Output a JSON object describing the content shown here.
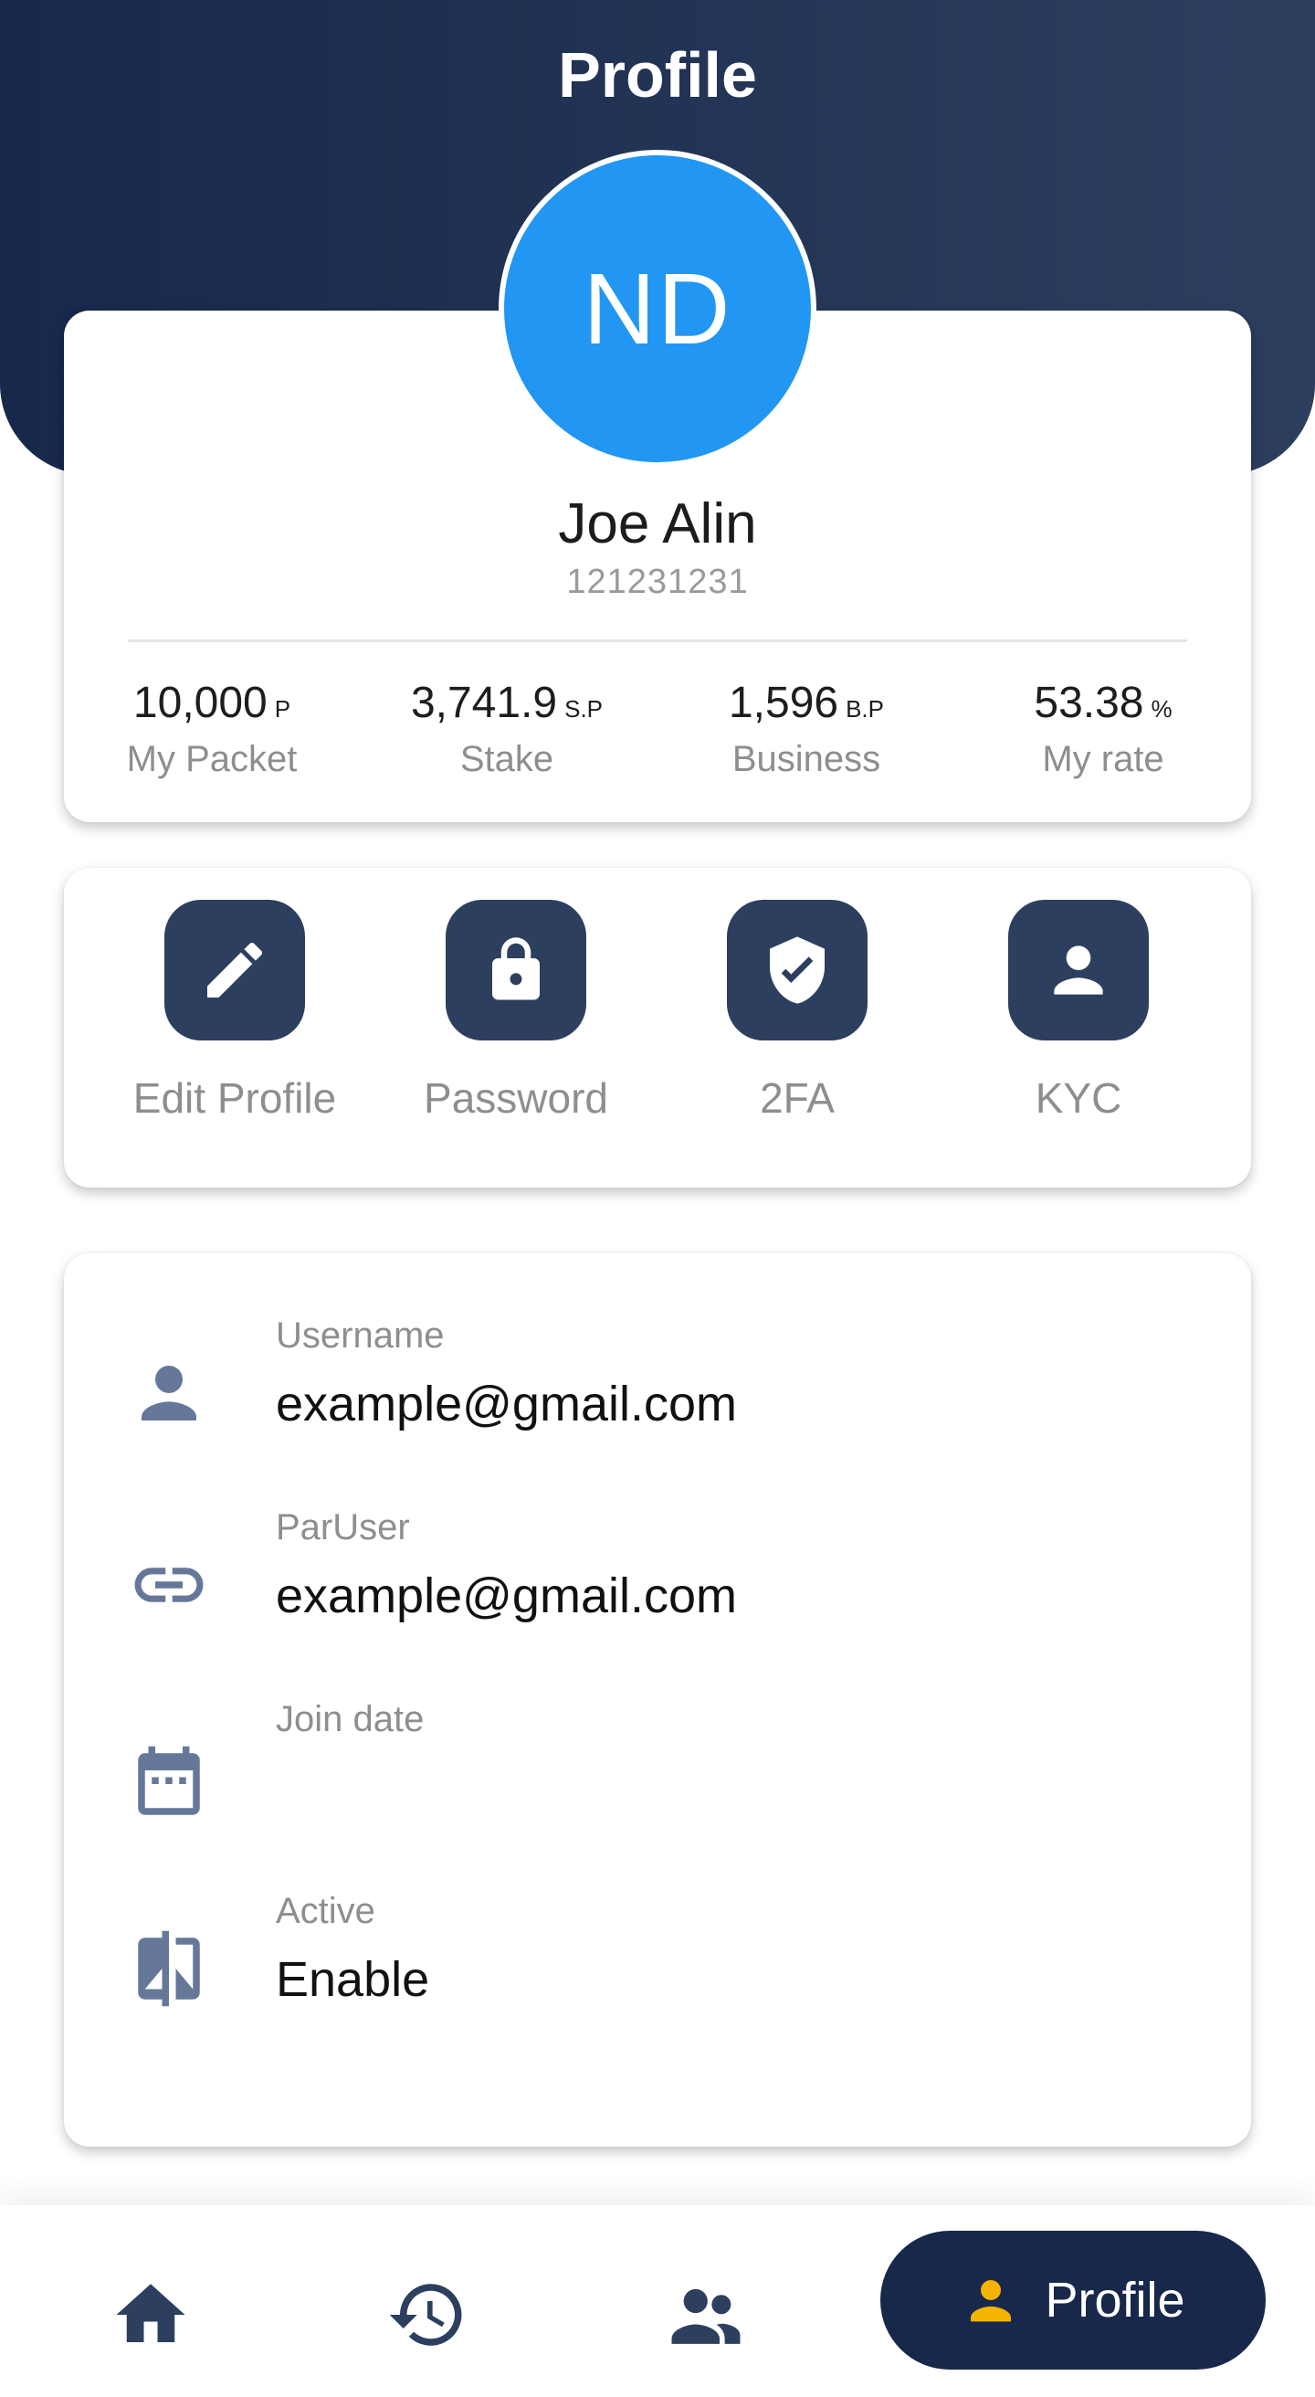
{
  "header": {
    "title": "Profile"
  },
  "profile": {
    "initials": "ND",
    "name": "Joe Alin",
    "id": "121231231",
    "stats": [
      {
        "value": "10,000",
        "unit": "P",
        "label": "My Packet"
      },
      {
        "value": "3,741.9",
        "unit": "S.P",
        "label": "Stake"
      },
      {
        "value": "1,596",
        "unit": "B.P",
        "label": "Business"
      },
      {
        "value": "53.38",
        "unit": "%",
        "label": "My rate"
      }
    ]
  },
  "actions": [
    {
      "label": "Edit Profile",
      "icon": "pencil-icon"
    },
    {
      "label": "Password",
      "icon": "lock-icon"
    },
    {
      "label": "2FA",
      "icon": "shield-check-icon"
    },
    {
      "label": "KYC",
      "icon": "person-icon"
    }
  ],
  "info": [
    {
      "label": "Username",
      "value": "example@gmail.com",
      "icon": "person-icon"
    },
    {
      "label": "ParUser",
      "value": "example@gmail.com",
      "icon": "link-icon"
    },
    {
      "label": "Join date",
      "value": "",
      "icon": "calendar-icon"
    },
    {
      "label": "Active",
      "value": "Enable",
      "icon": "compare-icon"
    }
  ],
  "bottom_nav": {
    "items": [
      {
        "icon": "home-icon"
      },
      {
        "icon": "history-icon"
      },
      {
        "icon": "group-icon"
      }
    ],
    "active": {
      "icon": "person-icon",
      "label": "Profile"
    }
  },
  "colors": {
    "header": "#17284a",
    "avatar": "#2196f3",
    "icon_bg": "#2d3f5f",
    "accent_yellow": "#f5b400",
    "info_icon": "#65789a"
  }
}
